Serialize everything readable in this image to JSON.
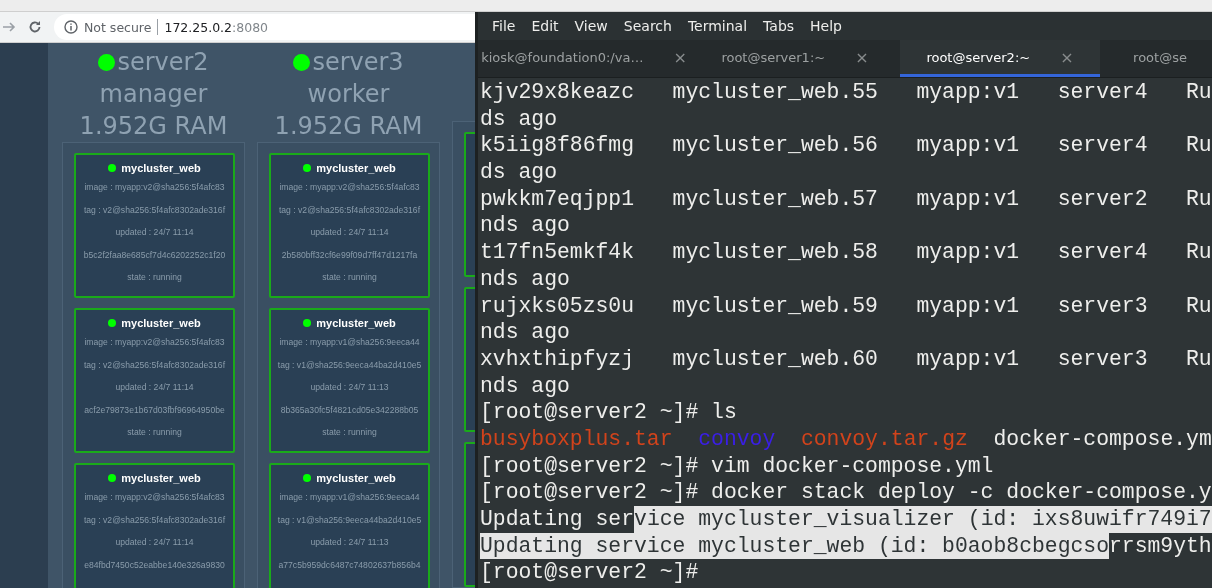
{
  "browser": {
    "security_label": "Not secure",
    "address_host": "172.25.0.2",
    "address_port": ":8080",
    "nodes": [
      {
        "name": "server2",
        "role": "manager",
        "memory": "1.952G RAM",
        "healthy": true,
        "services": [
          {
            "title": "mycluster_web",
            "healthy": true,
            "lines": [
              "image : myapp:v2@sha256:5f4afc83",
              "tag : v2@sha256:5f4afc8302ade316f",
              "updated : 24/7 11:14",
              "b5c2f2faa8e685cf7d4c6202252c1f20",
              "state : running"
            ]
          },
          {
            "title": "mycluster_web",
            "healthy": true,
            "lines": [
              "image : myapp:v2@sha256:5f4afc83",
              "tag : v2@sha256:5f4afc8302ade316f",
              "updated : 24/7 11:14",
              "acf2e79873e1b67d03fbf96964950be",
              "state : running"
            ]
          },
          {
            "title": "mycluster_web",
            "healthy": true,
            "lines": [
              "image : myapp:v2@sha256:5f4afc83",
              "tag : v2@sha256:5f4afc8302ade316f",
              "updated : 24/7 11:14",
              "e84fbd7450c52eabbe140e326a9830"
            ]
          }
        ]
      },
      {
        "name": "server3",
        "role": "worker",
        "memory": "1.952G RAM",
        "healthy": true,
        "services": [
          {
            "title": "mycluster_web",
            "healthy": true,
            "lines": [
              "image : myapp:v2@sha256:5f4afc83",
              "tag : v2@sha256:5f4afc8302ade316f",
              "updated : 24/7 11:14",
              "2b580bff32cf6e99f09d7ff47d1217fa",
              "state : running"
            ]
          },
          {
            "title": "mycluster_web",
            "healthy": true,
            "lines": [
              "image : myapp:v1@sha256:9eeca44",
              "tag : v1@sha256:9eeca44ba2d410e5",
              "updated : 24/7 11:13",
              "8b365a30fc5f4821cd05e342288b05",
              "state : running"
            ]
          },
          {
            "title": "mycluster_web",
            "healthy": true,
            "lines": [
              "image : myapp:v1@sha256:9eeca44",
              "tag : v1@sha256:9eeca44ba2d410e5",
              "updated : 24/7 11:13",
              "a77c5b959dc6487c74802637b856b4"
            ]
          }
        ]
      }
    ]
  },
  "terminal": {
    "menu": [
      "File",
      "Edit",
      "View",
      "Search",
      "Terminal",
      "Tabs",
      "Help"
    ],
    "tabs": [
      {
        "label": "kiosk@foundation0:/va…",
        "selected": false,
        "close": "×"
      },
      {
        "label": "root@server1:~",
        "selected": false,
        "close": "×"
      },
      {
        "label": "root@server2:~",
        "selected": true,
        "close": "×"
      },
      {
        "label": "root@se",
        "selected": false
      }
    ],
    "lines": [
      [
        {
          "text": "kjv29x8keazc   mycluster_web.55   myapp:v1   server4   Ru",
          "selected": false
        }
      ],
      [
        {
          "text": "ds ago",
          "selected": false
        }
      ],
      [
        {
          "text": "k5iig8f86fmg   mycluster_web.56   myapp:v1   server4   Ru",
          "selected": false
        }
      ],
      [
        {
          "text": "ds ago",
          "selected": false
        }
      ],
      [
        {
          "text": "pwkkm7eqjpp1   mycluster_web.57   myapp:v1   server2   Ru",
          "selected": false
        }
      ],
      [
        {
          "text": "nds ago",
          "selected": false
        }
      ],
      [
        {
          "text": "t17fn5emkf4k   mycluster_web.58   myapp:v1   server4   Ru",
          "selected": false
        }
      ],
      [
        {
          "text": "nds ago",
          "selected": false
        }
      ],
      [
        {
          "text": "rujxks05zs0u   mycluster_web.59   myapp:v1   server3   Ru",
          "selected": false
        }
      ],
      [
        {
          "text": "nds ago",
          "selected": false
        }
      ],
      [
        {
          "text": "xvhxthipfyzj   mycluster_web.60   myapp:v1   server3   Ru",
          "selected": false
        }
      ],
      [
        {
          "text": "nds ago",
          "selected": false
        }
      ],
      [
        {
          "text": "[root@server2 ~]# ls",
          "selected": false
        }
      ],
      [
        {
          "text": "busyboxplus.tar",
          "selected": false,
          "color": "#d2431b"
        },
        {
          "text": "  convoy",
          "selected": false,
          "color": "#3a1ee8"
        },
        {
          "text": "  convoy.tar.gz",
          "selected": false,
          "color": "#d2431b"
        },
        {
          "text": "  docker-compose.ym",
          "selected": false
        }
      ],
      [
        {
          "text": "[root@server2 ~]# vim docker-compose.yml",
          "selected": false
        }
      ],
      [
        {
          "text": "[root@server2 ~]# docker stack deploy -c docker-compose.y",
          "selected": false
        }
      ],
      [
        {
          "text": "Updating ser",
          "selected": false
        },
        {
          "text": "vice mycluster_visualizer (id: ixs8uwifr749i7",
          "selected": true
        }
      ],
      [
        {
          "text": "Updating service mycluster_web (id: b0aob8cbegcso",
          "selected": true
        },
        {
          "text": "rrsm9yth",
          "selected": false
        }
      ],
      [
        {
          "text": "[root@server2 ~]#",
          "selected": false
        }
      ]
    ]
  }
}
